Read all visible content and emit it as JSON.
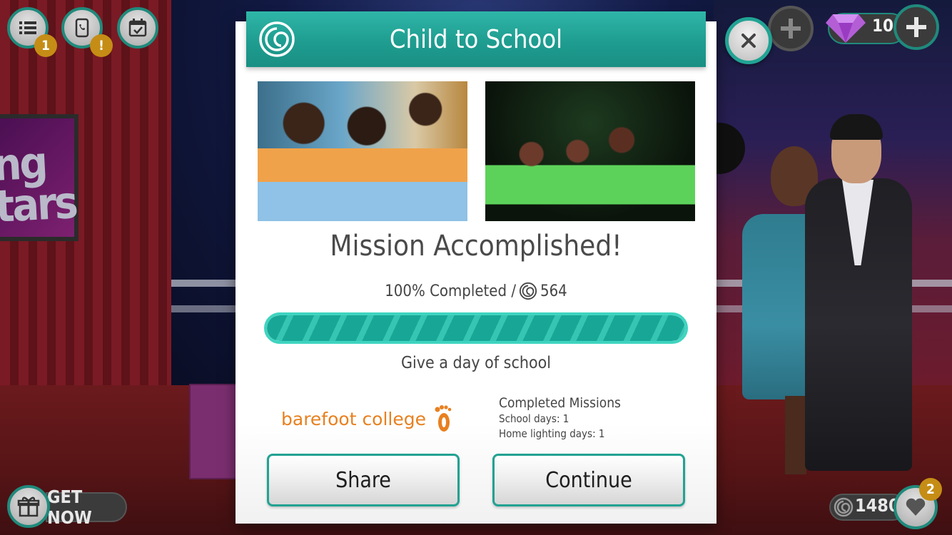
{
  "hud": {
    "menu_badge": "1",
    "phone_badge": "!",
    "gems_count": "10",
    "get_now_label": "GET NOW",
    "coins_count": "1480",
    "likes_badge": "2"
  },
  "background": {
    "sign_text": "ng\ntars"
  },
  "modal": {
    "title": "Child to School",
    "headline": "Mission Accomplished!",
    "progress_text": "100% Completed /",
    "reward_amount": "564",
    "progress_percent": 100,
    "description": "Give a day of school",
    "sponsor_name": "barefoot college",
    "completed_title": "Completed Missions",
    "completed_items": [
      "School days: 1",
      "Home lighting days: 1"
    ],
    "share_label": "Share",
    "continue_label": "Continue"
  },
  "colors": {
    "accent_teal": "#1e9d90",
    "badge_gold": "#c58d15",
    "sponsor_orange": "#e8801f"
  },
  "icons": [
    "list-icon",
    "phone-icon",
    "calendar-icon",
    "plus-icon",
    "gem-icon",
    "close-icon",
    "spiral-logo-icon",
    "foot-icon",
    "gift-icon",
    "coin-icon",
    "heart-icon"
  ]
}
